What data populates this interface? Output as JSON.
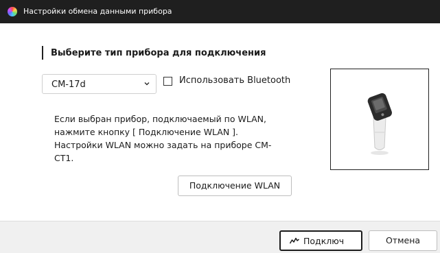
{
  "window": {
    "title": "Настройки обмена данными прибора",
    "icon": "color-wheel-icon"
  },
  "main": {
    "heading": "Выберите тип прибора для подключения",
    "device_select": {
      "value": "CM-17d"
    },
    "bluetooth": {
      "label": "Использовать Bluetooth",
      "checked": false
    },
    "info_lines": [
      "Если выбран прибор, подключаемый по WLAN,",
      "нажмите кнопку [ Подключение WLAN ].",
      "Настройки WLAN можно задать на приборе CM-",
      "CT1."
    ],
    "wlan_button_label": "Подключение WLAN"
  },
  "footer": {
    "connect_label": "Подключ",
    "connect_icon": "connect-wave-icon",
    "cancel_label": "Отмена"
  }
}
